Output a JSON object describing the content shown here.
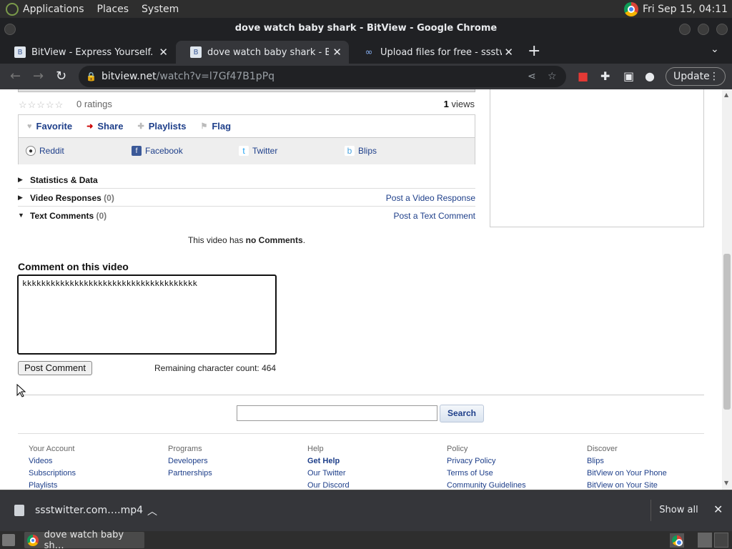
{
  "panel": {
    "applications": "Applications",
    "places": "Places",
    "system": "System",
    "clock": "Fri Sep 15, 04:11"
  },
  "window": {
    "title": "dove watch baby shark - BitView - Google Chrome"
  },
  "tabs": [
    {
      "title": "BitView - Express Yourself.",
      "icon": "bitview-favicon",
      "close": "✕"
    },
    {
      "title": "dove watch baby shark - BitView",
      "icon": "bitview-favicon",
      "close": "✕"
    },
    {
      "title": "Upload files for free - ssstwitter",
      "icon": "ssstwitter-favicon",
      "close": "✕"
    }
  ],
  "toolbar": {
    "url_host": "bitview.net",
    "url_path": "/watch?v=l7Gf47B1pPq",
    "update_label": "Update"
  },
  "video": {
    "ratings_text": "0 ratings",
    "views_count": "1",
    "views_label": "views"
  },
  "actions": {
    "favorite": "Favorite",
    "share": "Share",
    "playlists": "Playlists",
    "flag": "Flag"
  },
  "social": {
    "reddit": "Reddit",
    "facebook": "Facebook",
    "twitter": "Twitter",
    "blips": "Blips"
  },
  "sections": {
    "statistics": "Statistics & Data",
    "video_responses": "Video Responses",
    "video_responses_count": "(0)",
    "post_video_response": "Post a Video Response",
    "text_comments": "Text Comments",
    "text_comments_count": "(0)",
    "post_text_comment": "Post a Text Comment"
  },
  "comments": {
    "no_comments_prefix": "This video has ",
    "no_comments_bold": "no Comments",
    "no_comments_suffix": ".",
    "heading": "Comment on this video",
    "textarea_value": "kkkkkkkkkkkkkkkkkkkkkkkkkkkkkkkkkkkkk",
    "post_button": "Post Comment",
    "remaining": "Remaining character count: 464"
  },
  "search": {
    "button": "Search",
    "value": ""
  },
  "footer": {
    "your_account": {
      "heading": "Your Account",
      "links": [
        "Videos",
        "Subscriptions",
        "Playlists"
      ]
    },
    "programs": {
      "heading": "Programs",
      "links": [
        "Developers",
        "Partnerships"
      ]
    },
    "help": {
      "heading": "Help",
      "links": [
        "Get Help",
        "Our Twitter",
        "Our Discord"
      ]
    },
    "policy": {
      "heading": "Policy",
      "links": [
        "Privacy Policy",
        "Terms of Use",
        "Community Guidelines"
      ]
    },
    "discover": {
      "heading": "Discover",
      "links": [
        "Blips",
        "BitView on Your Phone",
        "BitView on Your Site"
      ]
    }
  },
  "downloads": {
    "filename": "ssstwitter.com….mp4",
    "show_all": "Show all"
  },
  "taskbar": {
    "task_title": "dove watch baby sh…"
  }
}
